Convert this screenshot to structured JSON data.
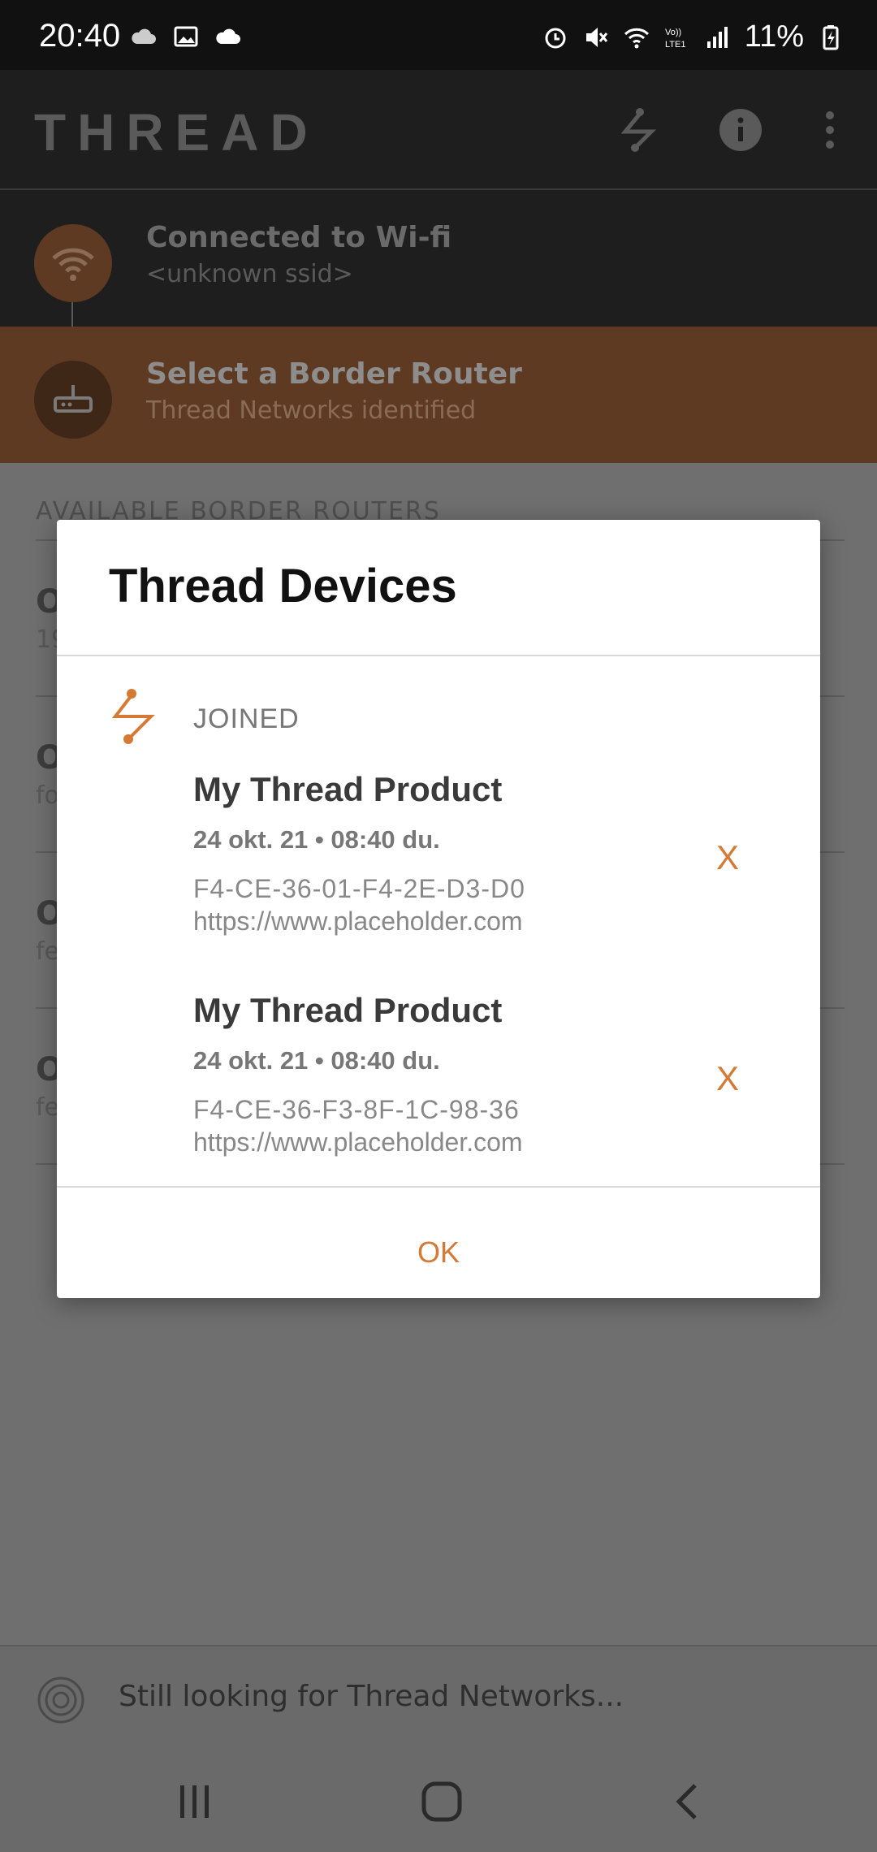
{
  "status_bar": {
    "time": "20:40",
    "battery": "11%"
  },
  "app_bar": {
    "logo": "THREAD"
  },
  "wifi_step": {
    "title": "Connected to Wi-fi",
    "subtitle": "<unknown ssid>"
  },
  "router_step": {
    "title": "Select a Border Router",
    "subtitle": "Thread Networks identified"
  },
  "list": {
    "header": "AVAILABLE BORDER ROUTERS",
    "rows": [
      {
        "letter": "O",
        "sub": "19"
      },
      {
        "letter": "O",
        "sub": "fo"
      },
      {
        "letter": "O",
        "sub": "fe"
      },
      {
        "letter": "O",
        "sub": "fe"
      }
    ]
  },
  "bottom": {
    "looking": "Still looking for Thread Networks..."
  },
  "dialog": {
    "title": "Thread Devices",
    "section_label": "JOINED",
    "devices": [
      {
        "name": "My Thread Product",
        "time": "24 okt. 21 • 08:40 du.",
        "id": "F4-CE-36-01-F4-2E-D3-D0",
        "url": "https://www.placeholder.com",
        "remove": "X"
      },
      {
        "name": "My Thread Product",
        "time": "24 okt. 21 • 08:40 du.",
        "id": "F4-CE-36-F3-8F-1C-98-36",
        "url": "https://www.placeholder.com",
        "remove": "X"
      }
    ],
    "ok_label": "OK"
  },
  "colors": {
    "accent": "#d57a35",
    "router_bg": "#5e3a22",
    "dark_bg": "#1e1e1e"
  }
}
